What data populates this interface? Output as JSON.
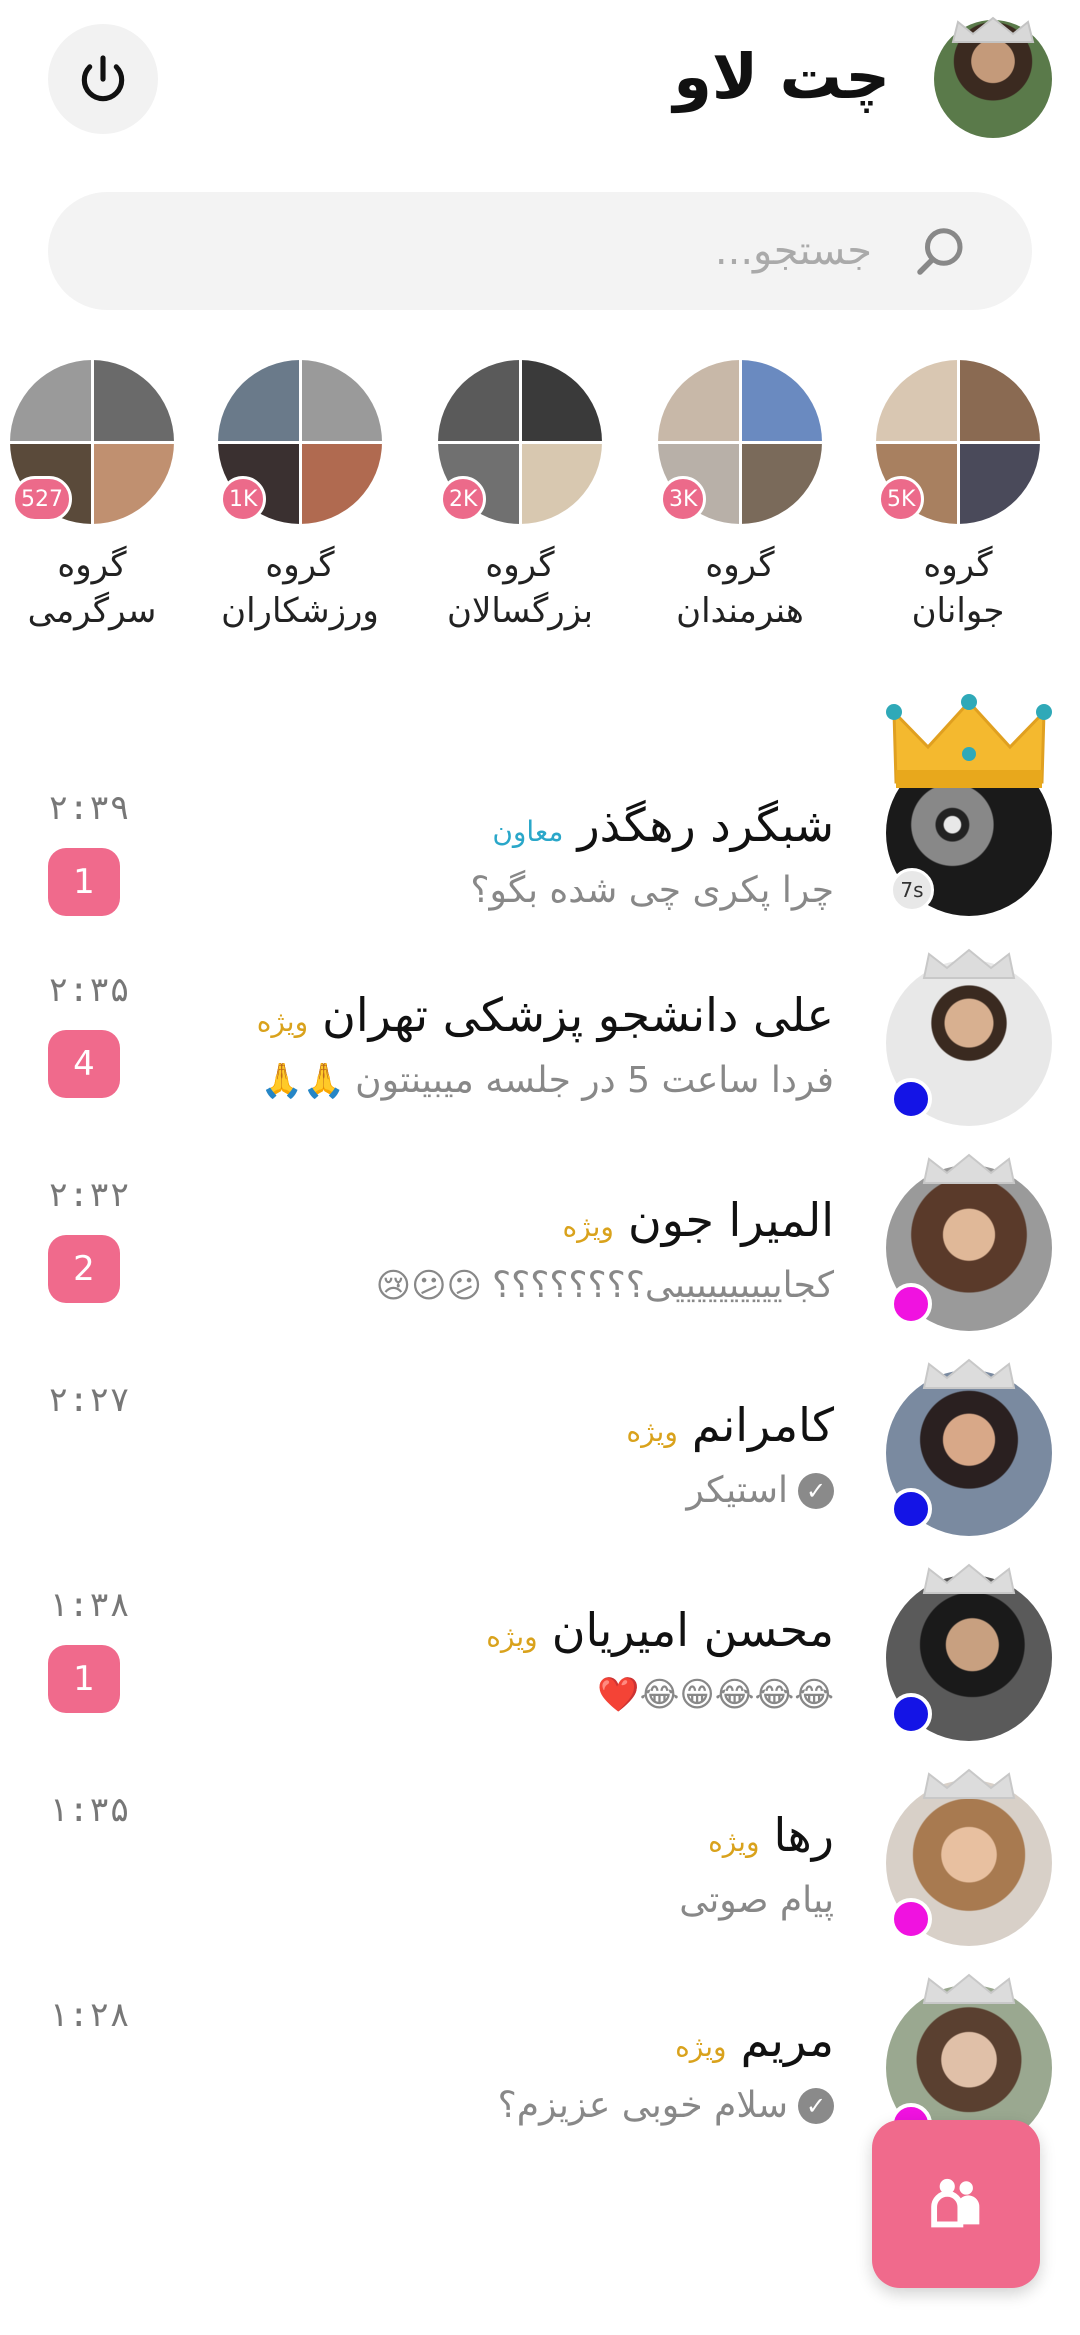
{
  "header": {
    "title": "چت لاو",
    "power_icon": "power-icon",
    "profile_icon": "avatar"
  },
  "search": {
    "placeholder": "جستجو..."
  },
  "groups": [
    {
      "line1": "گروه",
      "line2": "جوانان",
      "count": "5K"
    },
    {
      "line1": "گروه",
      "line2": "هنرمندان",
      "count": "3K"
    },
    {
      "line1": "گروه",
      "line2": "بزرگسالان",
      "count": "2K"
    },
    {
      "line1": "گروه",
      "line2": "ورزشکاران",
      "count": "1K"
    },
    {
      "line1": "گروه",
      "line2": "سرگرمی",
      "count": "527"
    }
  ],
  "chats": [
    {
      "name": "شبگرد رهگذر",
      "tag": "معاون",
      "message": "چرا پکری چی شده بگو؟",
      "time": "۲:۳۹",
      "unread": "1",
      "badge": "7s",
      "emojis": ""
    },
    {
      "name": "علی دانشجو پزشکی تهران",
      "tag": "ویژه",
      "message": "فردا ساعت 5 در جلسه میبینتون",
      "time": "۲:۳۵",
      "unread": "4",
      "emojis": "🙏🙏"
    },
    {
      "name": "المیرا جون",
      "tag": "ویژه",
      "message": "کجاییییییییییی؟؟؟؟؟؟؟؟",
      "time": "۲:۳۲",
      "unread": "2",
      "emojis": "😕😕😢"
    },
    {
      "name": "کامرانم",
      "tag": "ویژه",
      "message": "استیکر",
      "time": "۲:۲۷",
      "unread": "",
      "emojis": ""
    },
    {
      "name": "محسن امیریان",
      "tag": "ویژه",
      "message": "",
      "time": "۱:۳۸",
      "unread": "1",
      "emojis": "😂😂😂😁😂❤️"
    },
    {
      "name": "رها",
      "tag": "ویژه",
      "message": "پیام صوتی",
      "time": "۱:۳۵",
      "unread": "",
      "emojis": ""
    },
    {
      "name": "مریم",
      "tag": "ویژه",
      "message": "سلام خوبی عزیزم؟",
      "time": "۱:۲۸",
      "unread": "",
      "emojis": ""
    }
  ],
  "colors": {
    "accent": "#f06a8c",
    "vip": "#d9a21c",
    "deputy": "#2aa7c9",
    "online_blue": "#1414e6",
    "online_magenta": "#f012e0"
  },
  "fab": {
    "icon": "new-group-icon"
  }
}
